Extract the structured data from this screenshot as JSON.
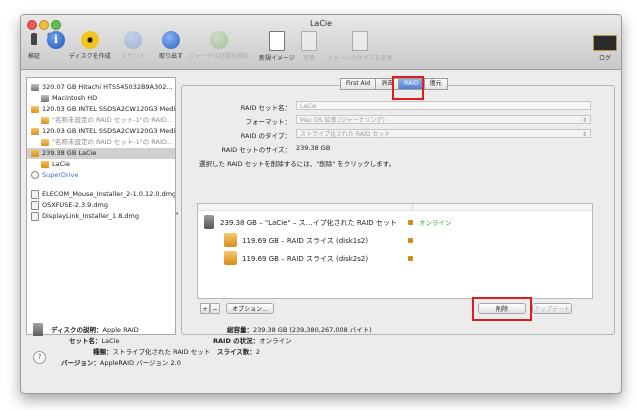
{
  "window": {
    "title": "LaCie"
  },
  "toolbar": {
    "items": [
      {
        "label": "検証",
        "icon": "microscope-icon",
        "enabled": true
      },
      {
        "label": "情報",
        "icon": "info-icon",
        "enabled": true
      },
      {
        "label": "ディスクを作成",
        "icon": "burn-icon",
        "enabled": true
      },
      {
        "label": "マウント",
        "icon": "mount-icon",
        "enabled": false
      },
      {
        "label": "取り出す",
        "icon": "eject-icon",
        "enabled": true
      },
      {
        "label": "ジャーナル記録を開始",
        "icon": "enable-journaling-icon",
        "enabled": false
      },
      {
        "label": "新規イメージ",
        "icon": "new-image-icon",
        "enabled": true
      },
      {
        "label": "変換",
        "icon": "convert-icon",
        "enabled": false
      },
      {
        "label": "イメージのサイズを変更",
        "icon": "resize-image-icon",
        "enabled": false
      },
      {
        "label": "ログ",
        "icon": "log-icon",
        "enabled": true
      }
    ]
  },
  "sidebar": {
    "items": [
      {
        "label": "320.07 GB Hitachi HTS545032B9A302...",
        "kind": "hdd",
        "level": 0
      },
      {
        "label": "Macintosh HD",
        "kind": "hdd",
        "level": 1
      },
      {
        "label": "120.03 GB INTEL SSDSA2CW120G3 Media",
        "kind": "usb",
        "level": 0
      },
      {
        "label": "\"名称未設定の RAID セット-1\"の RAID...",
        "kind": "usb",
        "level": 1,
        "muted": true
      },
      {
        "label": "120.03 GB INTEL SSDSA2CW120G3 Media",
        "kind": "usb",
        "level": 0
      },
      {
        "label": "\"名称未設定の RAID セット-1\"の RAID...",
        "kind": "usb",
        "level": 1,
        "muted": true
      },
      {
        "label": "239.38 GB LaCie",
        "kind": "raid",
        "level": 0,
        "selected": true
      },
      {
        "label": "LaCie",
        "kind": "raid",
        "level": 1
      },
      {
        "label": "SuperDrive",
        "kind": "net",
        "level": 0,
        "blue": true
      }
    ],
    "images": [
      {
        "label": "ELECOM_Mouse_Installer_2-1.0.12.0.dmg"
      },
      {
        "label": "OSXFUSE-2.3.9.dmg"
      },
      {
        "label": "DisplayLink_Installer_1.8.dmg"
      }
    ]
  },
  "tabs": [
    {
      "label": "First Aid",
      "active": false
    },
    {
      "label": "消去",
      "active": false
    },
    {
      "label": "RAID",
      "active": true
    },
    {
      "label": "復元",
      "active": false
    }
  ],
  "form": {
    "set_name_label": "RAID セット名：",
    "set_name_value": "LaCie",
    "format_label": "フォーマット：",
    "format_value": "Mac OS 拡張 (ジャーナリング)",
    "type_label": "RAID のタイプ：",
    "type_value": "ストライプ化された RAID セット",
    "size_label": "RAID セットのサイズ：",
    "size_value": "239.38 GB",
    "instruction": "選択した RAID セットを削除するには、\"削除\" をクリックします。"
  },
  "raid_list": {
    "set": {
      "label": "239.38 GB – \"LaCie\" – ス…イプ化された RAID セット",
      "status": "オンライン"
    },
    "slices": [
      {
        "label": "119.69 GB – RAID スライス (disk1s2)"
      },
      {
        "label": "119.69 GB – RAID スライス (disk2s2)"
      }
    ]
  },
  "buttons": {
    "add": "+",
    "remove": "−",
    "options": "オプション...",
    "delete": "削除",
    "update": "アップデート"
  },
  "info": {
    "description_label": "ディスクの説明：",
    "description_value": "Apple RAID",
    "set_label": "セット名：",
    "set_value": "LaCie",
    "kind_label": "種類：",
    "kind_value": "ストライプ化された RAID セット",
    "version_label": "バージョン：",
    "version_value": "AppleRAID バージョン 2.0",
    "capacity_label": "総容量：",
    "capacity_value": "239.38 GB (239,380,267,008 バイト)",
    "status_label": "RAID の状況：",
    "status_value": "オンライン",
    "slices_label": "スライス数：",
    "slices_value": "2"
  },
  "colors": {
    "highlight": "#e01c1c",
    "online": "#3aa83a",
    "tab_active": "#4d7fd3"
  }
}
